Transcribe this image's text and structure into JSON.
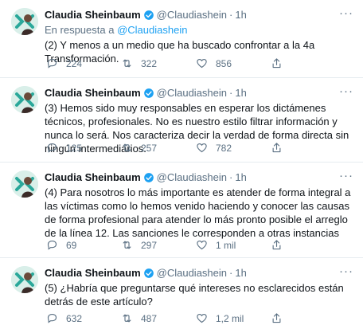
{
  "icons": {
    "reply": "reply-icon",
    "retweet": "retweet-icon",
    "like": "heart-icon",
    "share": "share-icon",
    "more": "more-icon",
    "verified": "verified-badge-icon"
  },
  "colors": {
    "handle": "#5b7083",
    "link": "#1da1f2",
    "verified": "#1da1f2"
  },
  "tweets": [
    {
      "name": "Claudia Sheinbaum",
      "handle": "@Claudiashein",
      "dot": "·",
      "time": "1h",
      "reply_prefix": "En respuesta a",
      "reply_mention": "@Claudiashein",
      "text": "(2) Y menos a un medio que ha buscado confrontar a la 4a Transformación.",
      "replies": "224",
      "retweets": "322",
      "likes": "856"
    },
    {
      "name": "Claudia Sheinbaum",
      "handle": "@Claudiashein",
      "dot": "·",
      "time": "1h",
      "text": "(3) Hemos sido muy responsables en esperar los dictámenes técnicos, profesionales. No es nuestro estilo filtrar información y nunca lo será. Nos caracteriza decir la verdad de forma directa sin ningún intermediarios.",
      "replies": "125",
      "retweets": "257",
      "likes": "782"
    },
    {
      "name": "Claudia Sheinbaum",
      "handle": "@Claudiashein",
      "dot": "·",
      "time": "1h",
      "text": "(4) Para nosotros lo más importante es atender de forma integral a las víctimas como lo hemos venido haciendo y conocer  las causas de forma profesional para atender lo más pronto posible el arreglo de la línea 12. Las sanciones le corresponden a otras instancias",
      "replies": "69",
      "retweets": "297",
      "likes": "1 mil"
    },
    {
      "name": "Claudia Sheinbaum",
      "handle": "@Claudiashein",
      "dot": "·",
      "time": "1h",
      "text": "(5) ¿Habría que preguntarse qué intereses no esclarecidos están detrás de este artículo?",
      "replies": "632",
      "retweets": "487",
      "likes": "1,2 mil"
    }
  ]
}
